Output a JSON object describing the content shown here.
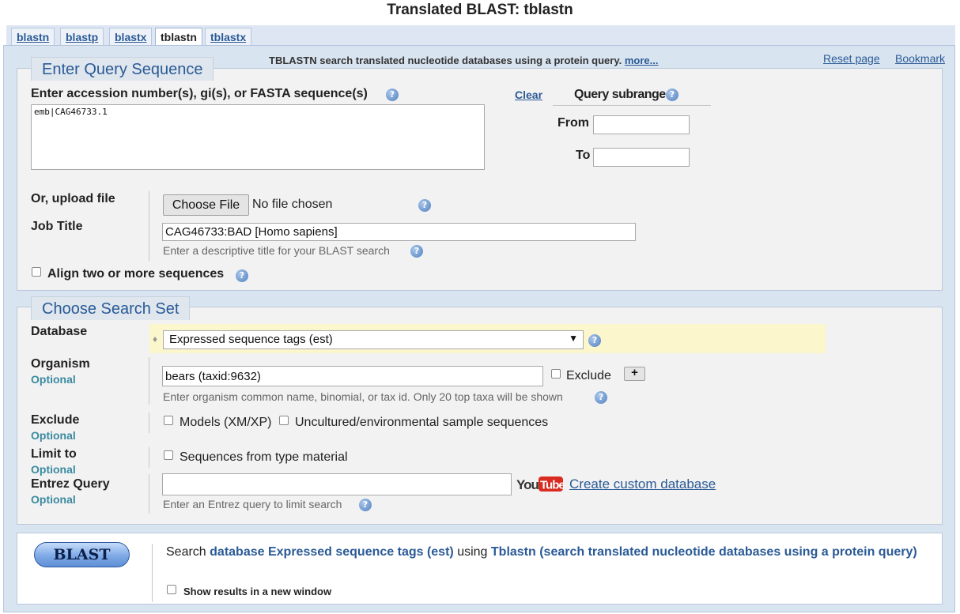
{
  "page": {
    "title": "Translated BLAST: tblastn"
  },
  "tabs": [
    {
      "label": "blastn"
    },
    {
      "label": "blastp"
    },
    {
      "label": "blastx"
    },
    {
      "label": "tblastn"
    },
    {
      "label": "tblastx"
    }
  ],
  "header": {
    "description": "TBLASTN search translated nucleotide databases using a protein query.",
    "more_link": "more...",
    "reset_page": "Reset page",
    "bookmark": "Bookmark"
  },
  "query": {
    "legend": "Enter Query Sequence",
    "seq_label": "Enter accession number(s), gi(s), or FASTA sequence(s)",
    "seq_value": "emb|CAG46733.1",
    "clear": "Clear",
    "subrange_label": "Query subrange",
    "from_label": "From",
    "to_label": "To",
    "from_value": "",
    "to_value": "",
    "upload_label": "Or, upload file",
    "choose_file": "Choose File",
    "no_file": "No file chosen",
    "job_title_label": "Job Title",
    "job_title_value": "CAG46733:BAD [Homo sapiens]",
    "job_title_hint": "Enter a descriptive title for your BLAST search",
    "align_label": "Align two or more sequences"
  },
  "search_set": {
    "legend": "Choose Search Set",
    "database_label": "Database",
    "database_value": "Expressed sequence tags (est)",
    "organism_label": "Organism",
    "optional": "Optional",
    "organism_value": "bears (taxid:9632)",
    "exclude_checkbox": "Exclude",
    "add_button": "+",
    "organism_hint": "Enter organism common name, binomial, or tax id. Only 20 top taxa will be shown",
    "exclude_label": "Exclude",
    "models_label": "Models (XM/XP)",
    "uncultured_label": "Uncultured/environmental sample sequences",
    "limit_label": "Limit to",
    "type_material_label": "Sequences from type material",
    "entrez_label": "Entrez Query",
    "entrez_value": "",
    "youtube_label": "YouTube",
    "custom_db_link": "Create custom database",
    "entrez_hint": "Enter an Entrez query to limit search"
  },
  "blast": {
    "button": "BLAST",
    "text_prefix": "Search",
    "text_db": "database Expressed sequence tags (est)",
    "text_using": "using",
    "text_program": "Tblastn (search translated nucleotide databases using a protein query)",
    "new_window": "Show results in a new window"
  },
  "colors": {
    "link": "#2a5a96",
    "panel_bg": "#f2f2f2",
    "frame_bg": "#d9e4f1",
    "db_highlight": "#fbf6cc"
  }
}
